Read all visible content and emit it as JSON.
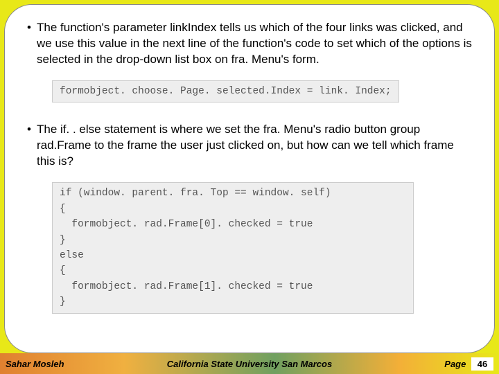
{
  "slide": {
    "bullets": [
      "The function's parameter linkIndex tells us which of the four links was clicked, and we use this value in the next line of the function's code to set which of the options is selected in the drop-down list box on fra. Menu's form.",
      "The if. . else statement is where we set the fra. Menu's radio button group rad.Frame to the frame the user just clicked on, but how can we tell which frame this is?"
    ],
    "code1": "formobject. choose. Page. selected.Index = link. Index;",
    "code2": "if (window. parent. fra. Top == window. self)\n{\n  formobject. rad.Frame[0]. checked = true\n}\nelse\n{\n  formobject. rad.Frame[1]. checked = true\n}"
  },
  "footer": {
    "author": "Sahar Mosleh",
    "institution": "California State University San Marcos",
    "page_label": "Page",
    "page_number": "46"
  }
}
